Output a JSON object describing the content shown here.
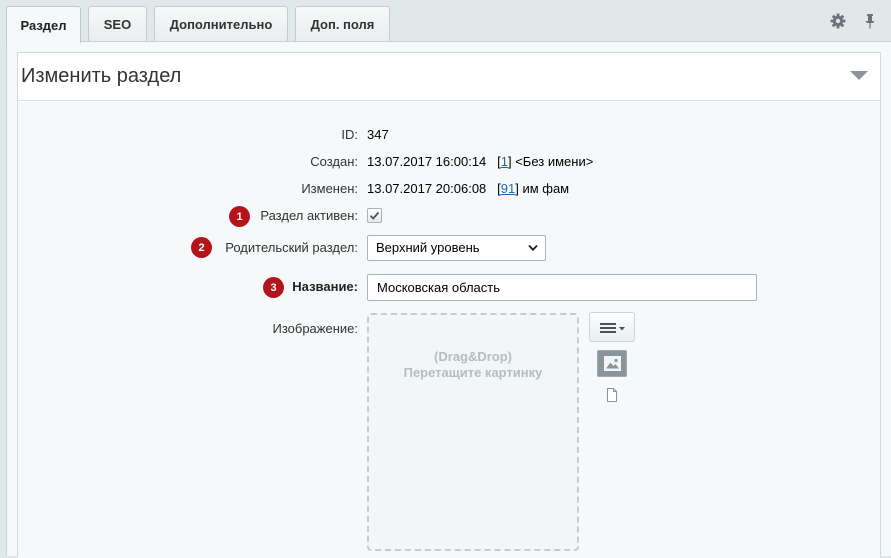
{
  "tabs": [
    {
      "label": "Раздел"
    },
    {
      "label": "SEO"
    },
    {
      "label": "Дополнительно"
    },
    {
      "label": "Доп. поля"
    }
  ],
  "panel": {
    "title": "Изменить раздел"
  },
  "fields": {
    "id": {
      "label": "ID:",
      "value": "347"
    },
    "created": {
      "label": "Создан:",
      "date": "13.07.2017 16:00:14",
      "user_id": "1",
      "user_name": "<Без имени>"
    },
    "modified": {
      "label": "Изменен:",
      "date": "13.07.2017 20:06:08",
      "user_id": "91",
      "user_name": "им фам"
    },
    "active": {
      "badge": "1",
      "label": "Раздел активен:",
      "checked": true
    },
    "parent": {
      "badge": "2",
      "label": "Родительский раздел:",
      "selected": "Верхний уровень"
    },
    "name": {
      "badge": "3",
      "label": "Название:",
      "value": "Московская область"
    },
    "image": {
      "label": "Изображение:",
      "drop_line1": "(Drag&Drop)",
      "drop_line2": "Перетащите картинку"
    }
  },
  "icons": {
    "settings": "gear-icon",
    "pin": "pin-icon",
    "menu": "menu-icon",
    "image": "image-icon",
    "file": "file-icon"
  },
  "colors": {
    "badge": "#b5141b",
    "link": "#2067b0"
  }
}
